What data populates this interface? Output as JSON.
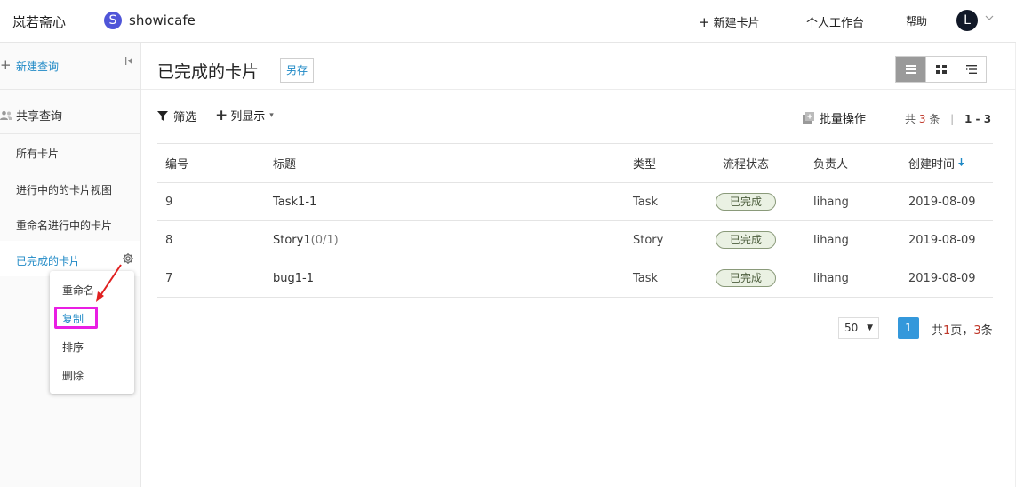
{
  "header": {
    "brand": "岚若斋心",
    "project_badge": "S",
    "project_name": "showicafe",
    "new_card": "新建卡片",
    "workbench": "个人工作台",
    "help": "帮助",
    "avatar": "L"
  },
  "sidebar": {
    "new_query": "新建查询",
    "shared_queries": "共享查询",
    "items": [
      {
        "label": "所有卡片"
      },
      {
        "label": "进行中的的卡片视图"
      },
      {
        "label": "重命名进行中的卡片"
      },
      {
        "label": "已完成的卡片"
      }
    ]
  },
  "context_menu": {
    "items": [
      "重命名",
      "复制",
      "排序",
      "删除"
    ]
  },
  "main": {
    "title": "已完成的卡片",
    "save_as": "另存",
    "filter": "筛选",
    "columns": "列显示",
    "bulk": "批量操作",
    "count_prefix": "共",
    "count_value": "3",
    "count_suffix": "条",
    "range": "1 - 3"
  },
  "table": {
    "headers": {
      "id": "编号",
      "title": "标题",
      "type": "类型",
      "status": "流程状态",
      "owner": "负责人",
      "created": "创建时间"
    },
    "rows": [
      {
        "id": "9",
        "title": "Task1-1",
        "progress": "",
        "type": "Task",
        "status": "已完成",
        "owner": "lihang",
        "created": "2019-08-09"
      },
      {
        "id": "8",
        "title": "Story1",
        "progress": "(0/1)",
        "type": "Story",
        "status": "已完成",
        "owner": "lihang",
        "created": "2019-08-09"
      },
      {
        "id": "7",
        "title": "bug1-1",
        "progress": "",
        "type": "Task",
        "status": "已完成",
        "owner": "lihang",
        "created": "2019-08-09"
      }
    ]
  },
  "pagination": {
    "page_size": "50",
    "current_page": "1",
    "summary_prefix": "共",
    "pages": "1",
    "summary_mid": "页，",
    "total": "3",
    "summary_suffix": "条"
  },
  "colors": {
    "accent": "#1f89c6",
    "highlight_box": "#e91ee3",
    "annotation_arrow": "#e02020",
    "status_bg": "#eaf1e3"
  },
  "icons": {
    "plus": "plus-icon",
    "collapse": "collapse-left-icon",
    "users": "users-icon",
    "gear": "gear-icon",
    "filter": "filter-icon",
    "list_view": "list-view-icon",
    "grid_view": "grid-view-icon",
    "tree_view": "tree-view-icon",
    "bulk": "bulk-icon",
    "sort_down": "sort-down-icon",
    "caret_down": "caret-down-icon"
  }
}
